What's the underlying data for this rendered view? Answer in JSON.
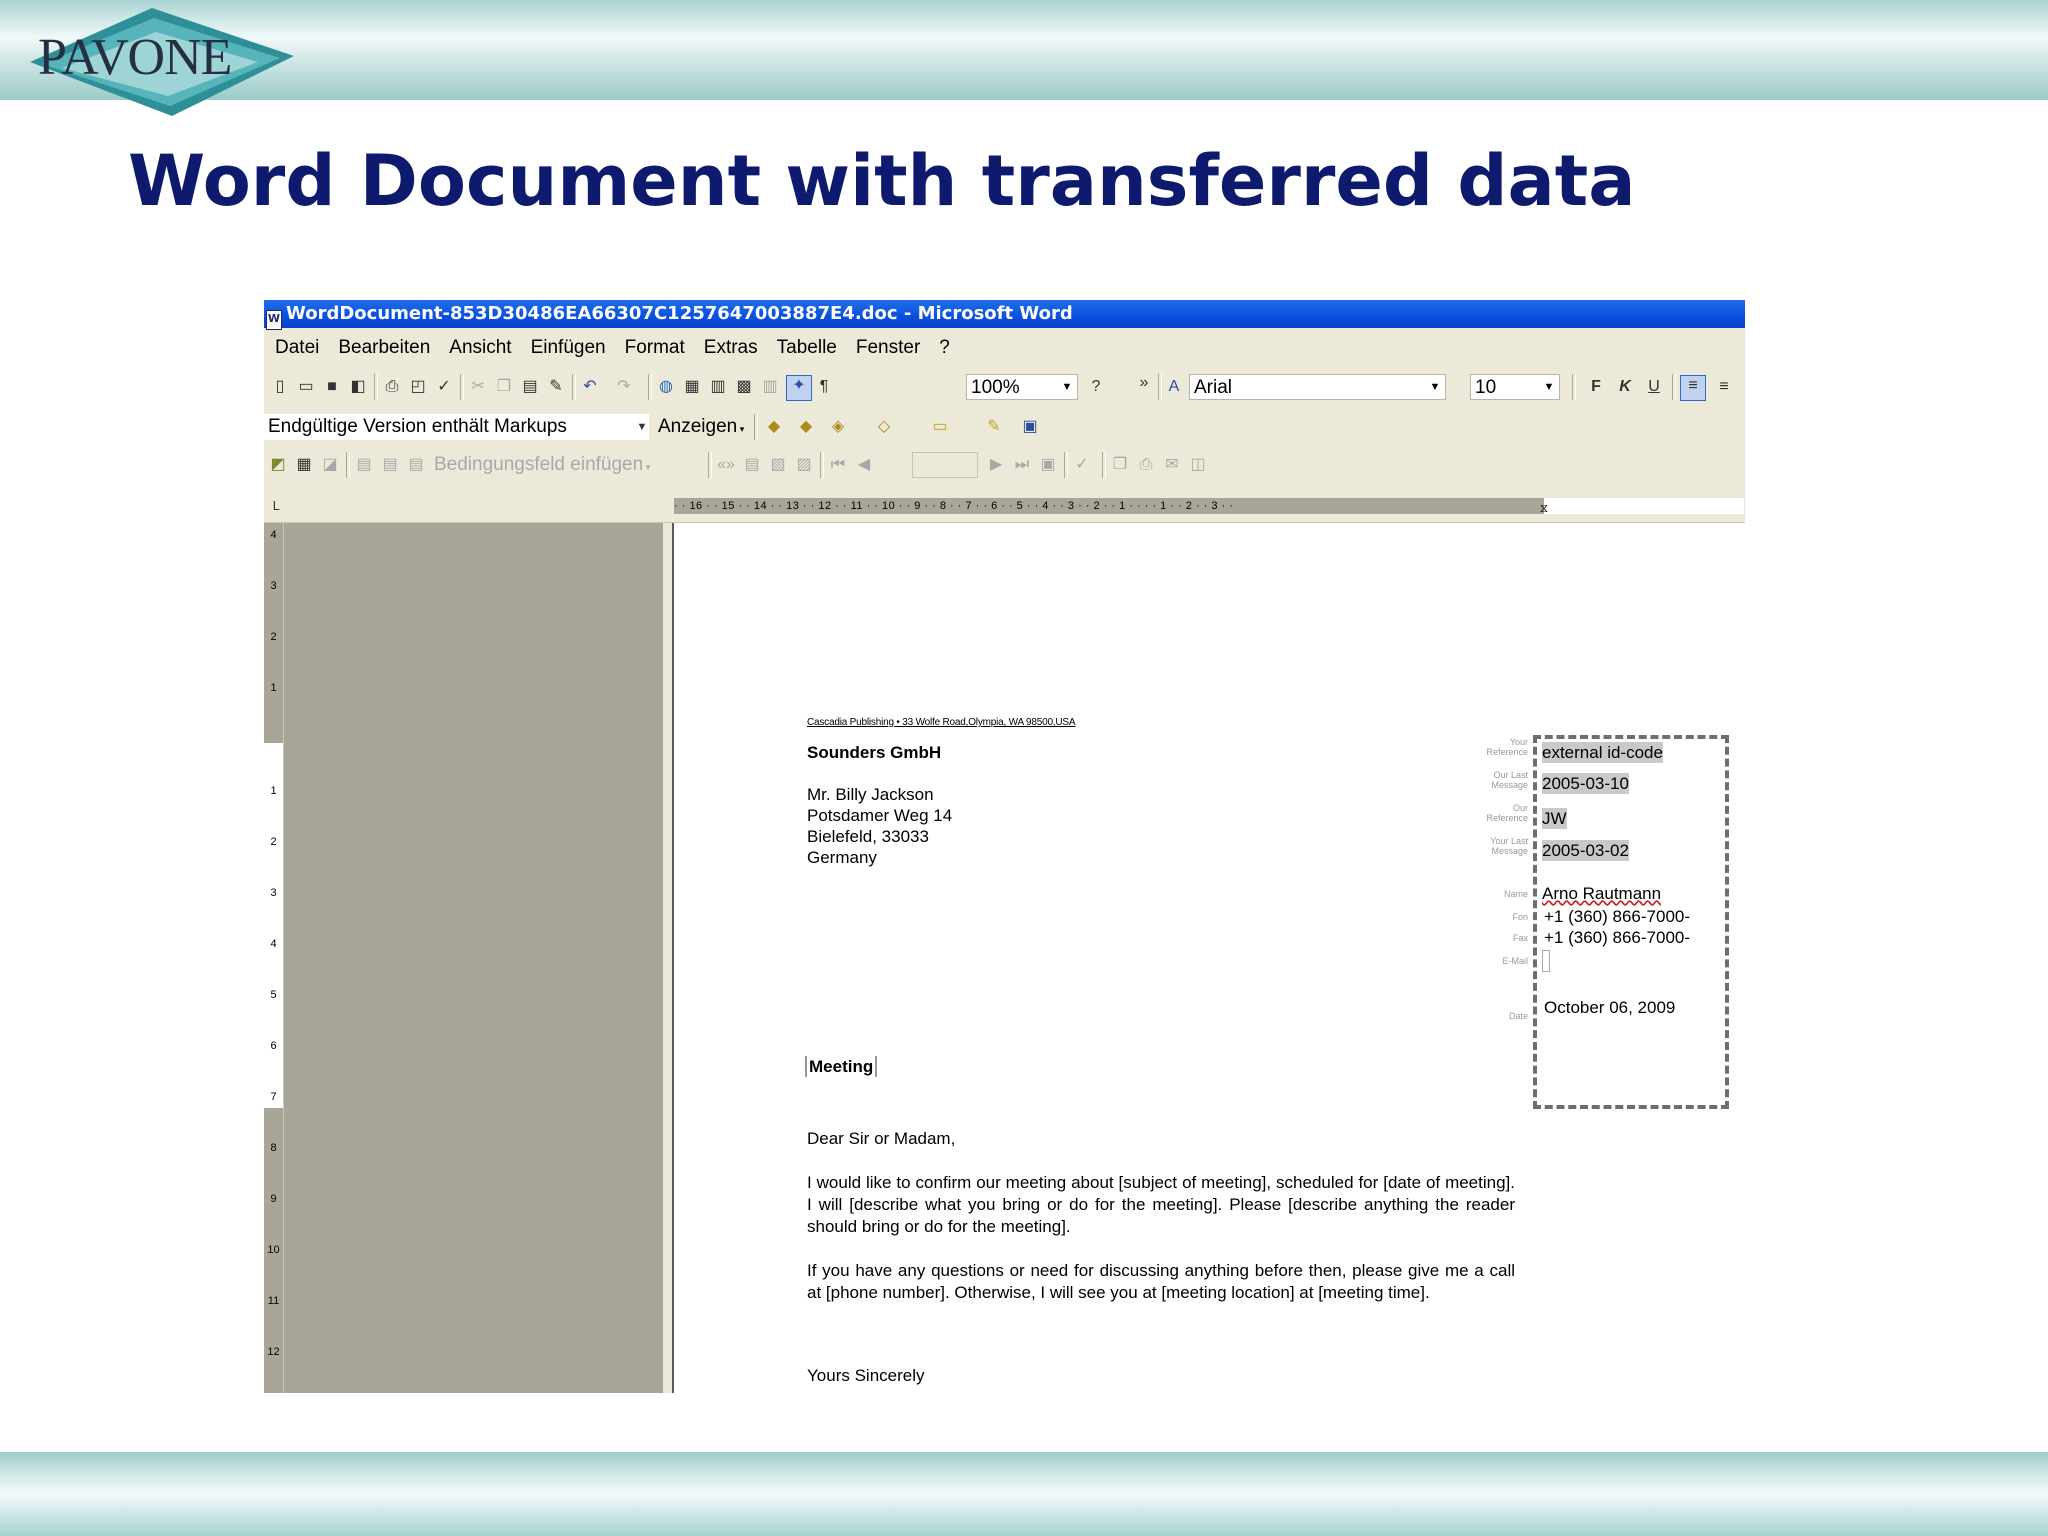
{
  "slide": {
    "logo_text": "PAVONE",
    "title": "Word Document with transferred data"
  },
  "window": {
    "title": "WordDocument-853D30486EA66307C1257647003887E4.doc - Microsoft Word",
    "menu": [
      "Datei",
      "Bearbeiten",
      "Ansicht",
      "Einfügen",
      "Format",
      "Extras",
      "Tabelle",
      "Fenster",
      "?"
    ],
    "toolbar1": {
      "zoom": "100%",
      "font": "Arial",
      "size": "10",
      "bold": "F",
      "italic": "K",
      "underline": "U"
    },
    "toolbar2": {
      "markup_view": "Endgültige Version enthält Markups",
      "show": "Anzeigen"
    },
    "toolbar3": {
      "insert_field": "Bedingungsfeld einfügen"
    },
    "ruler_text": "· · 16 · · 15 · · 14 · · 13 · · 12 · · 11 · · 10 · · 9 · · 8 · · 7 · · 6 · · 5 · · 4 · · 3 · · 2 · · 1 · · · · 1 · · 2 · · 3 · ·",
    "vruler_labels": [
      "4",
      "3",
      "2",
      "1",
      "1",
      "2",
      "3",
      "4",
      "5",
      "6",
      "7",
      "8",
      "9",
      "10",
      "11",
      "12"
    ]
  },
  "letter": {
    "sender_line": "Cascadia Publishing • 33 Wolfe Road,Olympia, WA 98500,USA",
    "company": "Sounders GmbH",
    "address": [
      "Mr. Billy Jackson",
      "Potsdamer Weg 14",
      "Bielefeld, 33033",
      "Germany"
    ],
    "subject": "Meeting",
    "salutation": "Dear Sir or Madam,",
    "paragraph1": "I would like to confirm our meeting about [subject of meeting], scheduled for [date of meeting]. I will [describe what you bring or do for the meeting]. Please [describe anything the reader should bring or do for the meeting].",
    "paragraph2": "If you have any questions or need for discussing anything before then, please give me a call at [phone number]. Otherwise, I will see you at [meeting location] at [meeting time].",
    "closing": "Yours Sincerely",
    "ref_box": {
      "labels": {
        "your_reference": "Your Reference",
        "our_last_message": "Our Last Message",
        "our_reference": "Our Reference",
        "your_last_message": "Your Last Message",
        "name": "Name",
        "fon": "Fon",
        "fax": "Fax",
        "email": "E-Mail",
        "date": "Date"
      },
      "your_reference": "external id-code",
      "our_last_message": "2005-03-10",
      "our_reference": "JW",
      "your_last_message": "2005-03-02",
      "name": "Arno Rautmann",
      "fon": "+1 (360) 866-7000-",
      "fax": "+1 (360) 866-7000-",
      "email": "",
      "date": "October 06, 2009"
    }
  },
  "colors": {
    "title_blue": "#0d1a6e",
    "titlebar_blue": "#0a4fe0",
    "band_teal": "#9ccbc9",
    "sidebar_grey": "#a9a599"
  }
}
